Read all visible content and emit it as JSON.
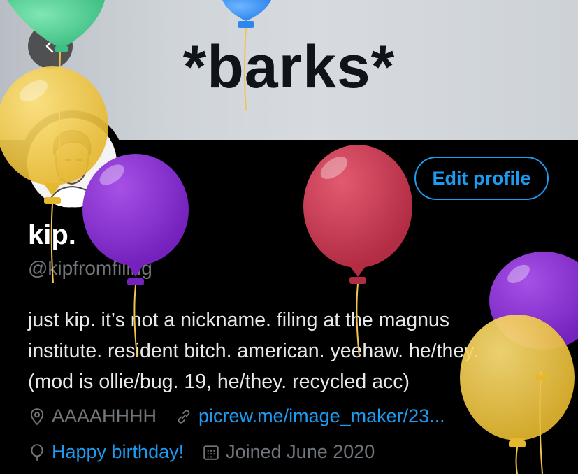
{
  "header": {
    "banner_text": "*barks*",
    "back_icon": "chevron-left-icon"
  },
  "profile": {
    "edit_button_label": "Edit profile",
    "display_name": "kip.",
    "handle": "@kipfromfiling",
    "bio_lines": [
      "just kip. it’s not a nickname. filing at the magnus",
      "institute. resident bitch. american. yeehaw. he/they.",
      "(mod is ollie/bug. 19, he/they. recycled acc)"
    ],
    "location": "AAAAHHHH",
    "website": "picrew.me/image_maker/23...",
    "birthday": "Happy birthday!",
    "joined": "Joined June 2020"
  },
  "colors": {
    "accent": "#1d9bf0",
    "muted_text": "#71767b",
    "background": "#000000",
    "balloon_yellow": "#f4cf4f",
    "balloon_purple": "#8e2fd0",
    "balloon_red": "#c93a52",
    "balloon_green": "#5fd39a",
    "balloon_blue": "#3f9bff"
  },
  "icons": [
    "chevron-left-icon",
    "location-pin-icon",
    "link-icon",
    "balloon-icon",
    "calendar-icon"
  ]
}
